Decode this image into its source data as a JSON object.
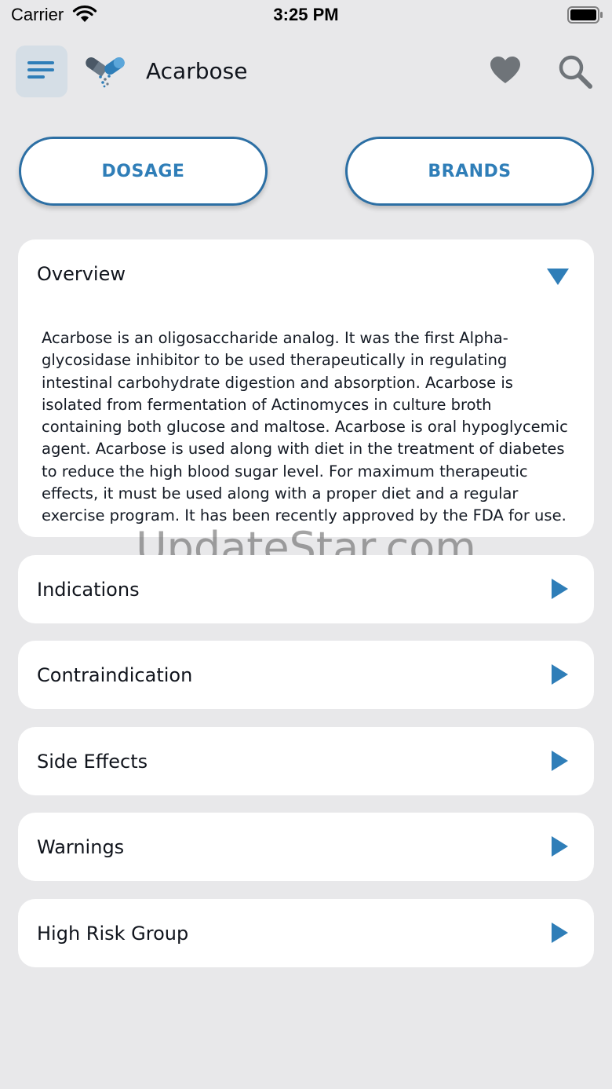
{
  "status_bar": {
    "carrier": "Carrier",
    "time": "3:25 PM"
  },
  "header": {
    "title": "Acarbose",
    "menu_icon": "hamburger-menu-icon",
    "logo_icon": "capsule-logo-icon",
    "favorite_icon": "heart-icon",
    "search_icon": "search-icon"
  },
  "buttons": {
    "dosage": "DOSAGE",
    "brands": "BRANDS"
  },
  "sections": {
    "overview": {
      "title": "Overview",
      "expanded": true,
      "text": "Acarbose is an oligosaccharide analog. It was the first Alpha-glycosidase inhibitor to be used therapeutically in regulating intestinal carbohydrate digestion and absorption. Acarbose is isolated from fermentation of Actinomyces in culture broth containing both glucose and maltose. Acarbose is oral hypoglycemic agent. Acarbose is used along with diet in the treatment of diabetes to reduce the high blood sugar level. For maximum therapeutic effects, it must be used along with a proper diet and a regular exercise program. It has been recently approved by the FDA for use."
    },
    "items": [
      {
        "title": "Indications"
      },
      {
        "title": "Contraindication"
      },
      {
        "title": "Side Effects"
      },
      {
        "title": "Warnings"
      },
      {
        "title": "High Risk Group"
      }
    ]
  },
  "watermark": "UpdateStar.com",
  "colors": {
    "accent": "#2f7eb8",
    "background": "#e8e8ea",
    "card": "#ffffff"
  }
}
